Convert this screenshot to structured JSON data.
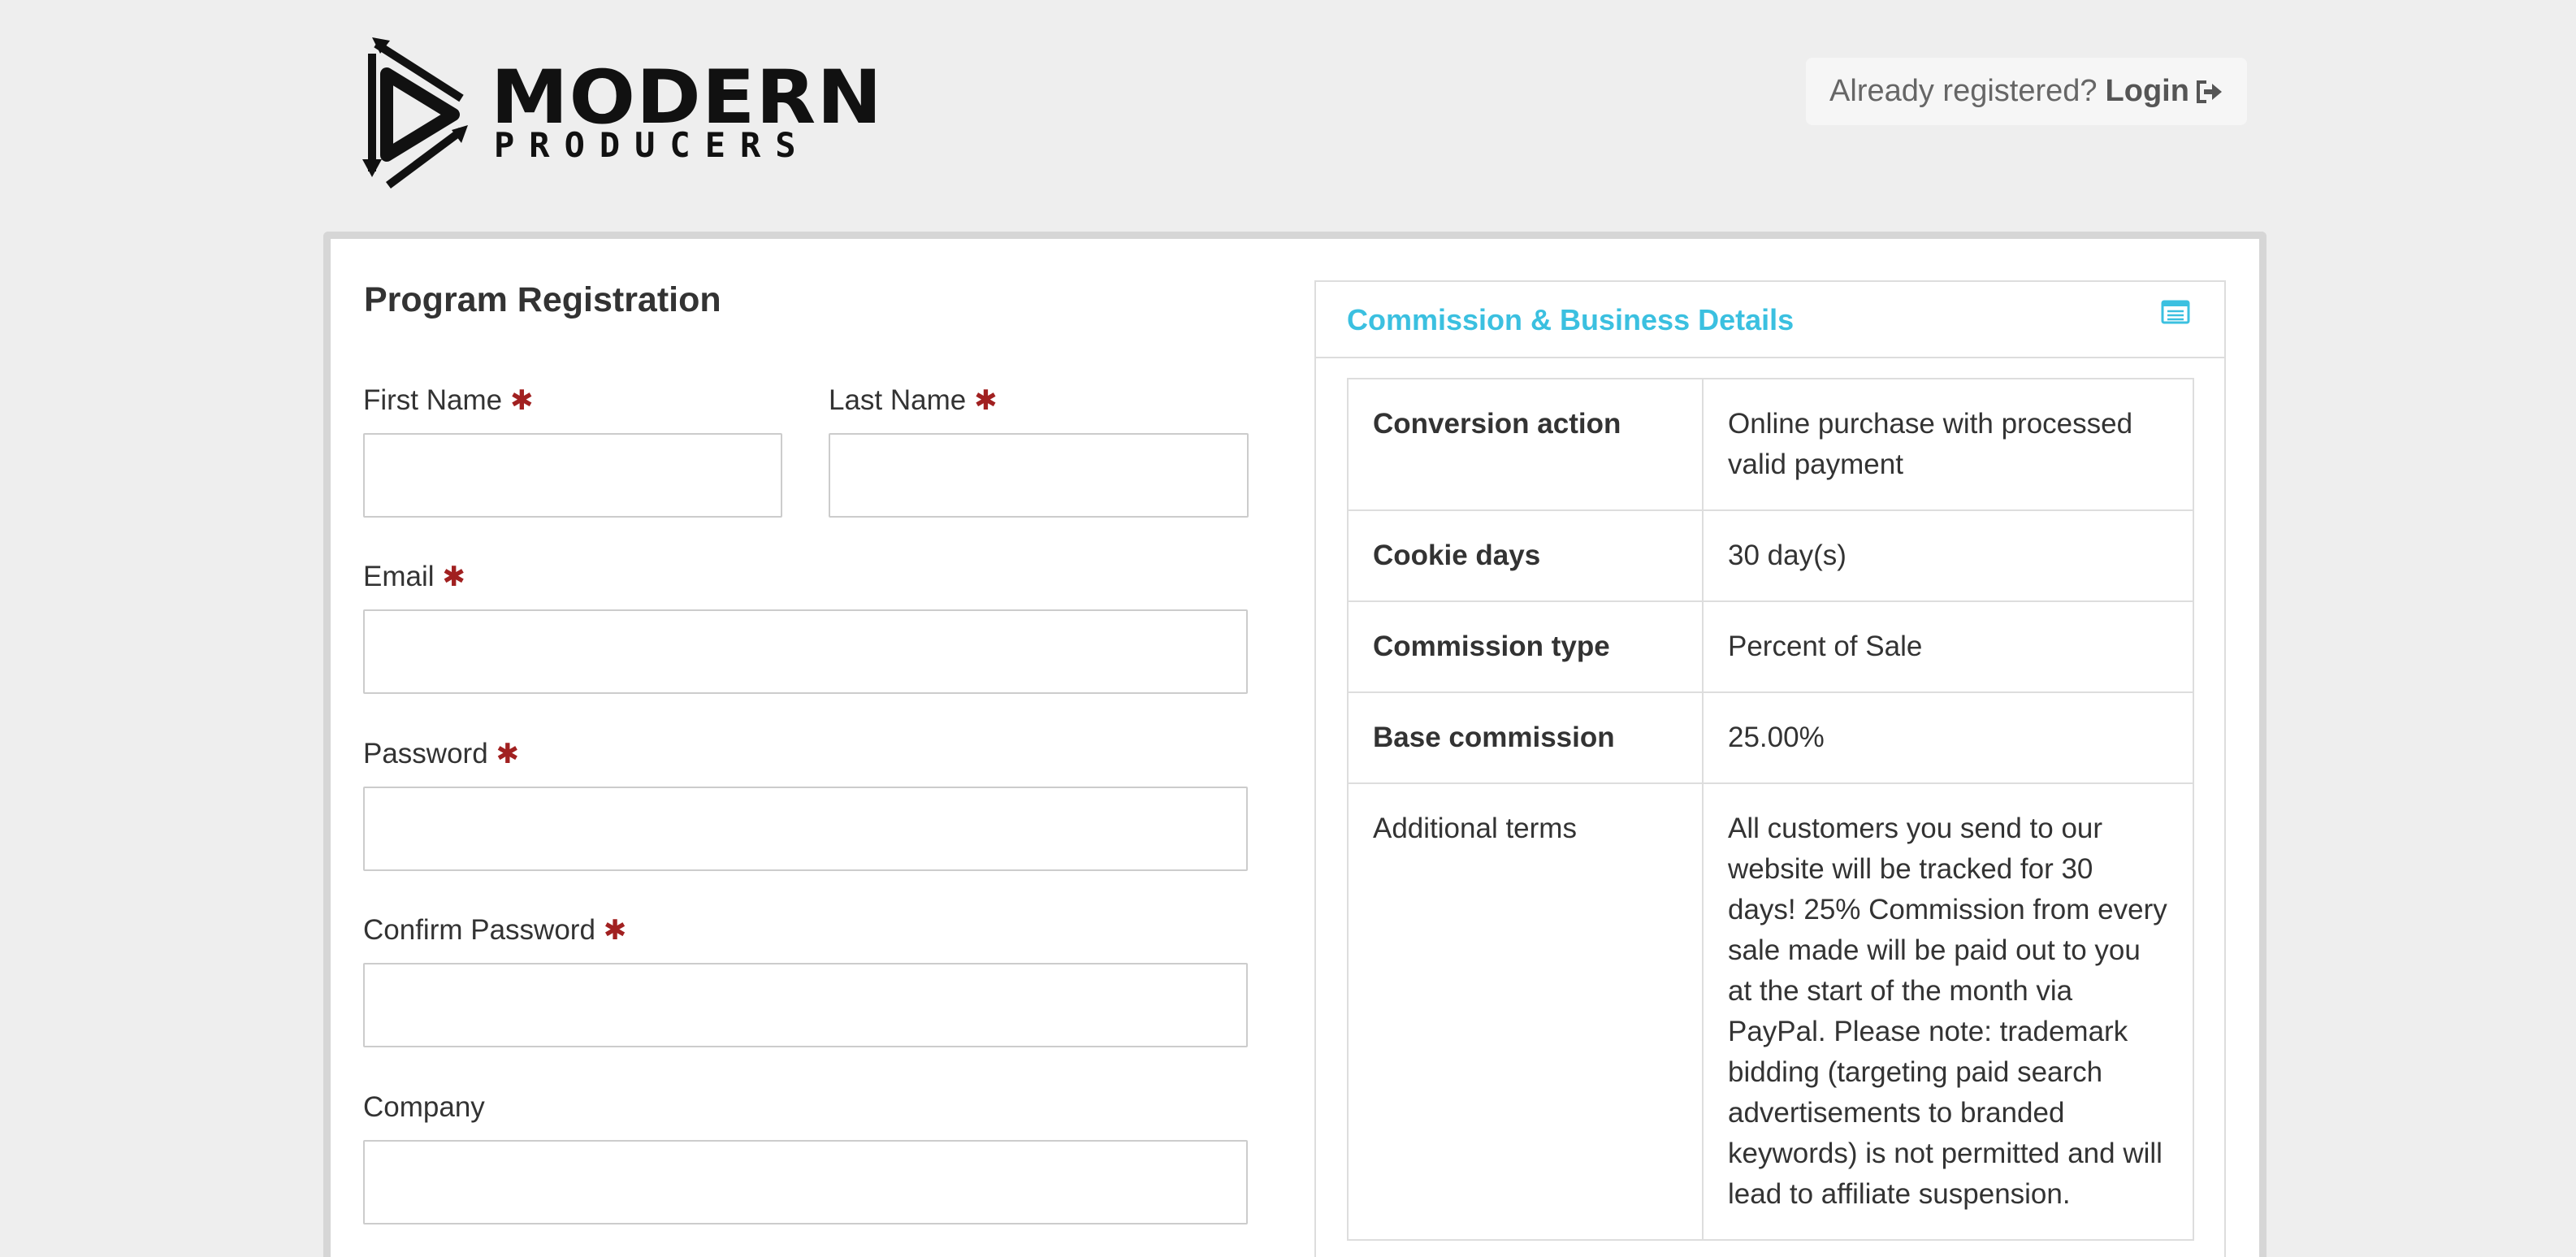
{
  "header": {
    "logo": {
      "line1": "MODERN",
      "line2": "PRODUCERS"
    },
    "login": {
      "prompt": "Already registered?",
      "link_label": "Login",
      "icon": "sign-in-icon"
    }
  },
  "form": {
    "title": "Program Registration",
    "required_marker": "✱",
    "fields": {
      "first_name": {
        "label": "First Name",
        "value": ""
      },
      "last_name": {
        "label": "Last Name",
        "value": ""
      },
      "email": {
        "label": "Email",
        "value": ""
      },
      "password": {
        "label": "Password",
        "value": ""
      },
      "confirm_password": {
        "label": "Confirm Password",
        "value": ""
      },
      "company": {
        "label": "Company",
        "value": ""
      }
    }
  },
  "details": {
    "title": "Commission & Business Details",
    "icon": "list-icon",
    "rows": [
      {
        "key": "Conversion action",
        "value": "Online purchase with processed valid payment"
      },
      {
        "key": "Cookie days",
        "value": "30 day(s)"
      },
      {
        "key": "Commission type",
        "value": "Percent of Sale"
      },
      {
        "key": "Base commission",
        "value": "25.00%"
      },
      {
        "key": "Additional terms",
        "value": "All customers you send to our website will be tracked for 30 days! 25% Commission from every sale made will be paid out to you at the start of the month via PayPal. Please note: trademark bidding (targeting paid search advertisements to branded keywords) is not permitted and will lead to affiliate suspension."
      }
    ]
  },
  "colors": {
    "accent": "#3bc0e0",
    "required": "#a12020",
    "background": "#eeeeee"
  }
}
